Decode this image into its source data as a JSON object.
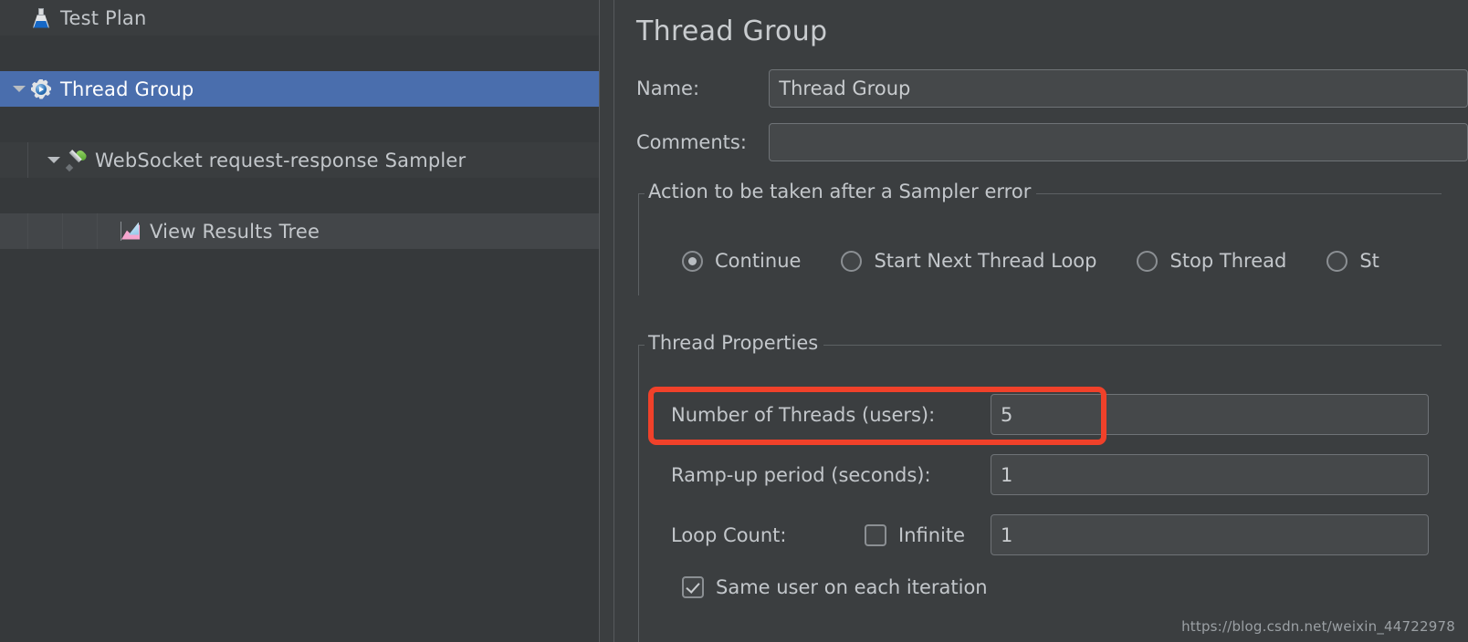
{
  "tree": {
    "rows": [
      {
        "label": "Test Plan",
        "icon": "flask-icon",
        "depth": 0,
        "expandable": false,
        "selected": false
      },
      {
        "label": "Thread Group",
        "icon": "gear-icon",
        "depth": 1,
        "expandable": true,
        "selected": true
      },
      {
        "label": "WebSocket request-response Sampler",
        "icon": "pipette-icon",
        "depth": 2,
        "expandable": true,
        "selected": false
      },
      {
        "label": "View Results Tree",
        "icon": "results-tree-icon",
        "depth": 3,
        "expandable": false,
        "selected": false
      }
    ]
  },
  "detail": {
    "title": "Thread Group",
    "name_label": "Name:",
    "name_value": "Thread Group",
    "comments_label": "Comments:",
    "comments_value": "",
    "sampler_error_group": {
      "title": "Action to be taken after a Sampler error",
      "options": [
        {
          "label": "Continue",
          "selected": true
        },
        {
          "label": "Start Next Thread Loop",
          "selected": false
        },
        {
          "label": "Stop Thread",
          "selected": false
        },
        {
          "label": "St",
          "selected": false
        }
      ]
    },
    "thread_properties_group": {
      "title": "Thread Properties",
      "threads_label": "Number of Threads (users):",
      "threads_value": "5",
      "rampup_label": "Ramp-up period (seconds):",
      "rampup_value": "1",
      "loop_count_label": "Loop Count:",
      "infinite_label": "Infinite",
      "infinite_checked": false,
      "loop_count_value": "1",
      "same_user_label": "Same user on each iteration",
      "same_user_checked": true
    }
  },
  "annotation": {
    "highlight_color": "#f0412a",
    "highlight_target": "Number of Threads (users): 5"
  },
  "watermark": "https://blog.csdn.net/weixin_44722978"
}
